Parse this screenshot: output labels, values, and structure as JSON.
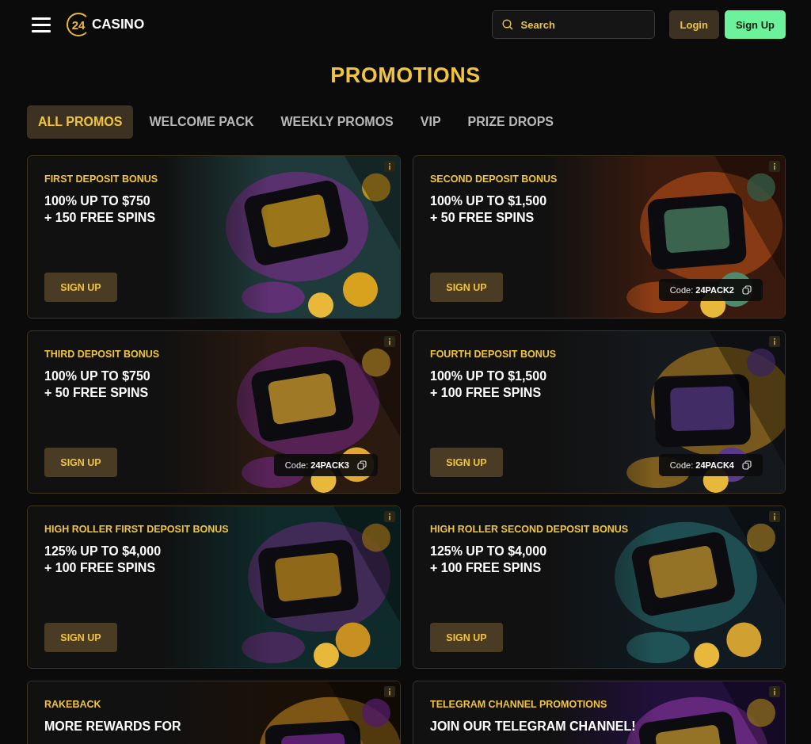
{
  "header": {
    "logo": {
      "number": "24",
      "name": "CASINO"
    },
    "search": {
      "placeholder": "Search"
    },
    "buttons": [
      {
        "kind": "login",
        "label": "Login"
      },
      {
        "kind": "signup",
        "label": "Sign Up"
      }
    ]
  },
  "title": "PROMOTIONS",
  "tabs": [
    {
      "label": "ALL PROMOS",
      "selected": true
    },
    {
      "label": "WELCOME PACK",
      "selected": false
    },
    {
      "label": "WEEKLY PROMOS",
      "selected": false
    },
    {
      "label": "VIP",
      "selected": false
    },
    {
      "label": "PRIZE DROPS",
      "selected": false
    }
  ],
  "promos": [
    {
      "label": "FIRST DEPOSIT BONUS",
      "lines": [
        "100% UP TO $750",
        "+ 150 FREE SPINS"
      ],
      "button": "SIGN UP",
      "picture": {
        "kind": "picture"
      }
    },
    {
      "label": "SECOND DEPOSIT BONUS",
      "lines": [
        "100% UP TO $1,500",
        "+ 50 FREE SPINS"
      ],
      "button": "SIGN UP",
      "code": "Code: **24PACK2**",
      "picture": {
        "kind": "picture"
      }
    },
    {
      "label": "THIRD DEPOSIT BONUS",
      "lines": [
        "100% UP TO $750",
        "+ 50 FREE SPINS"
      ],
      "button": "SIGN UP",
      "code": "Code: **24PACK3**",
      "picture": {
        "kind": "picture"
      }
    },
    {
      "label": "FOURTH DEPOSIT BONUS",
      "lines": [
        "100% UP TO $1,500",
        "+ 100 FREE SPINS"
      ],
      "button": "SIGN UP",
      "code": "Code: **24PACK4**",
      "picture": {
        "kind": "picture"
      }
    },
    {
      "label": "HIGH ROLLER FIRST DEPOSIT BONUS",
      "lines": [
        "125% UP TO $4,000",
        "+ 100 FREE SPINS"
      ],
      "button": "SIGN UP",
      "picture": {
        "kind": "picture"
      }
    },
    {
      "label": "HIGH ROLLER SECOND DEPOSIT BONUS",
      "lines": [
        "125% UP TO $4,000",
        "+ 100 FREE SPINS"
      ],
      "button": "SIGN UP",
      "picture": {
        "kind": "picture"
      }
    },
    {
      "label": "RAKEBACK",
      "lines": [
        "MORE REWARDS FOR"
      ],
      "picture": {
        "kind": "picture"
      }
    },
    {
      "label": "TELEGRAM CHANNEL PROMOTIONS",
      "lines": [
        "JOIN OUR TELEGRAM CHANNEL!"
      ],
      "picture": {
        "kind": "picture"
      }
    }
  ]
}
